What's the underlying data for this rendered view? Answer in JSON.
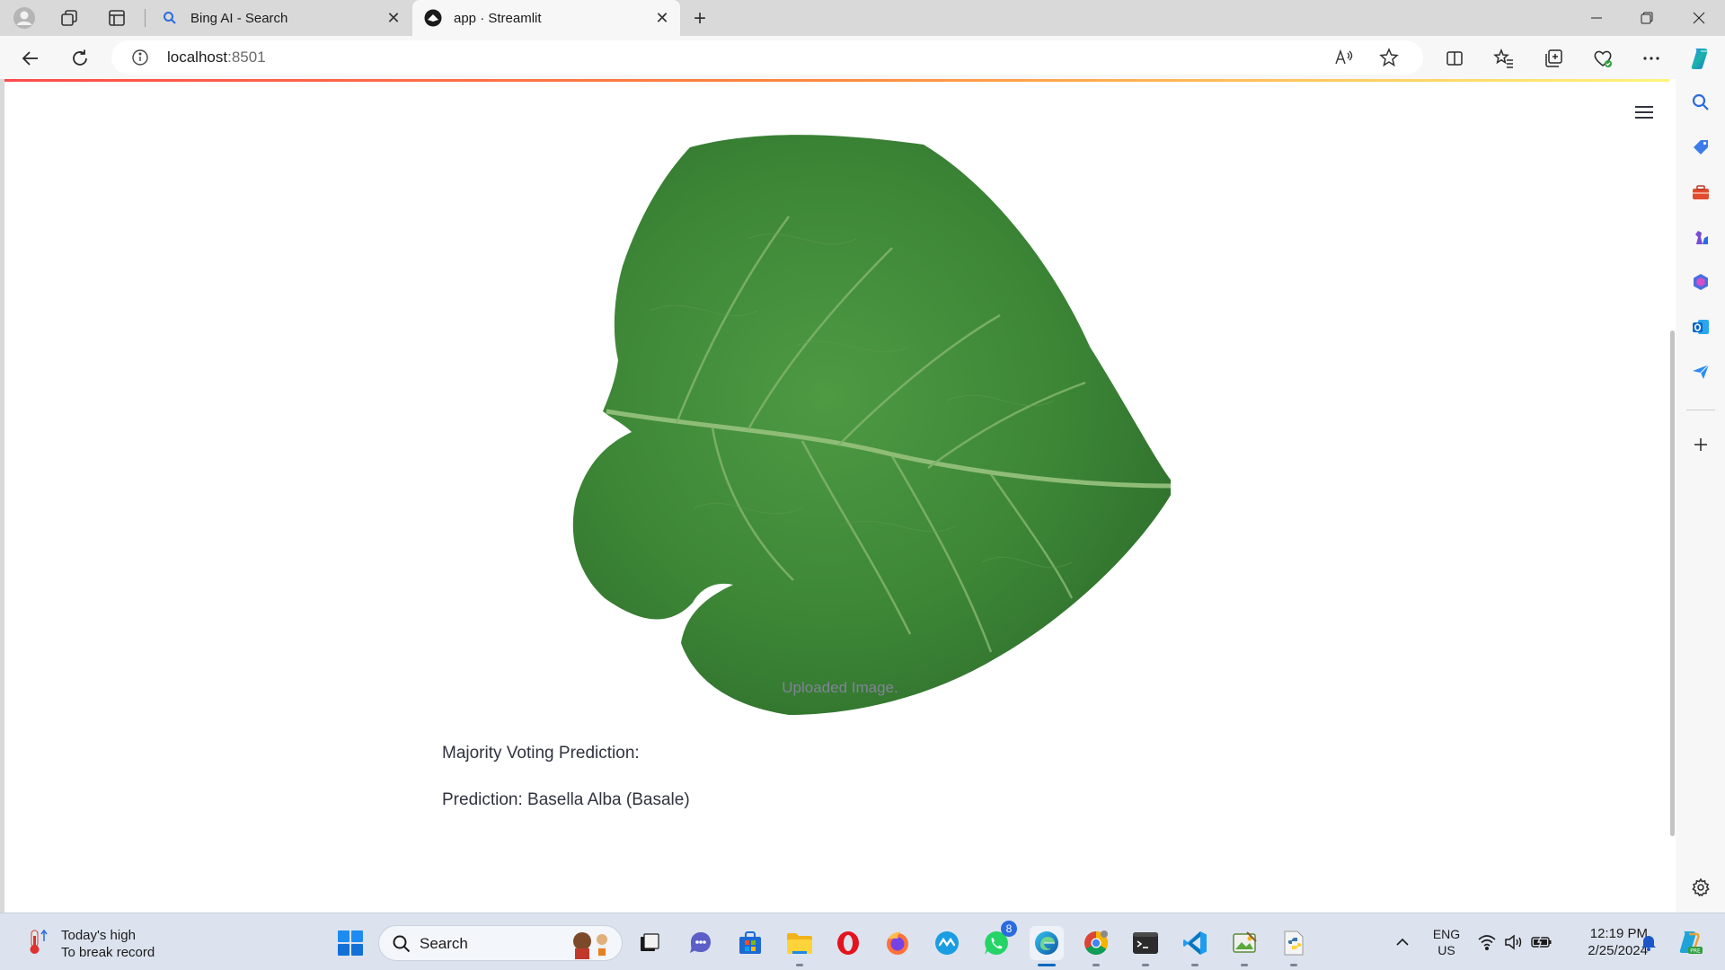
{
  "browser": {
    "tabs": [
      {
        "title": "Bing AI - Search",
        "favicon": "search-icon",
        "active": false
      },
      {
        "title": "app · Streamlit",
        "favicon": "streamlit-icon",
        "active": true
      }
    ],
    "address": {
      "host": "localhost",
      "port": ":8501"
    }
  },
  "page": {
    "image_caption": "Uploaded Image.",
    "majority_label": "Majority Voting Prediction:",
    "prediction_text": "Prediction: Basella Alba (Basale)"
  },
  "taskbar": {
    "weather": {
      "line1": "Today's high",
      "line2": "To break record"
    },
    "search_label": "Search",
    "whatsapp_badge": "8",
    "lang": {
      "line1": "ENG",
      "line2": "US"
    },
    "clock": {
      "time": "12:19 PM",
      "date": "2/25/2024"
    }
  },
  "colors": {
    "streamlit_accent": "#ff4b4b",
    "leaf_green": "#3f8a3a",
    "caption_gray": "#808495",
    "text_dark": "#31333f"
  }
}
